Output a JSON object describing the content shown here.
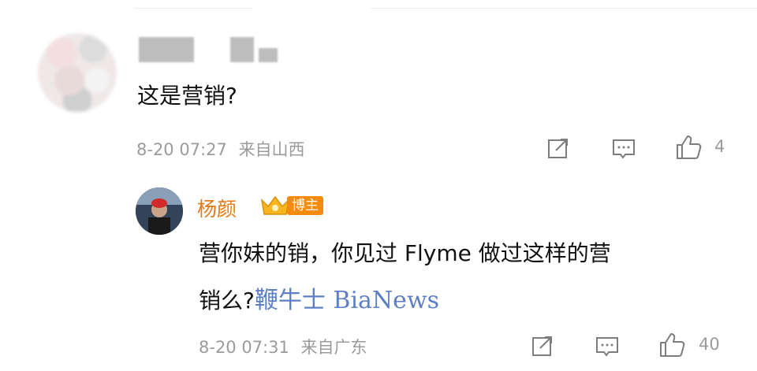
{
  "comment": {
    "text": "这是营销?",
    "time": "8-20 07:27",
    "location": "来自山西",
    "like_count": "4"
  },
  "reply": {
    "author": "杨颜",
    "badge": "博主",
    "line1": "营你妹的销，你见过 Flyme 做过这样的营",
    "line2": "销么?",
    "watermark": "鞭牛士 BiaNews",
    "time": "8-20 07:31",
    "location": "来自广东",
    "like_count": "40"
  },
  "colors": {
    "name": "#e07a17",
    "badge": "#f58b0c",
    "meta": "#9b9b9b",
    "watermark": "#5d7fc4"
  },
  "icons": [
    "share-icon",
    "comment-icon",
    "like-icon",
    "crown-badge-icon"
  ]
}
